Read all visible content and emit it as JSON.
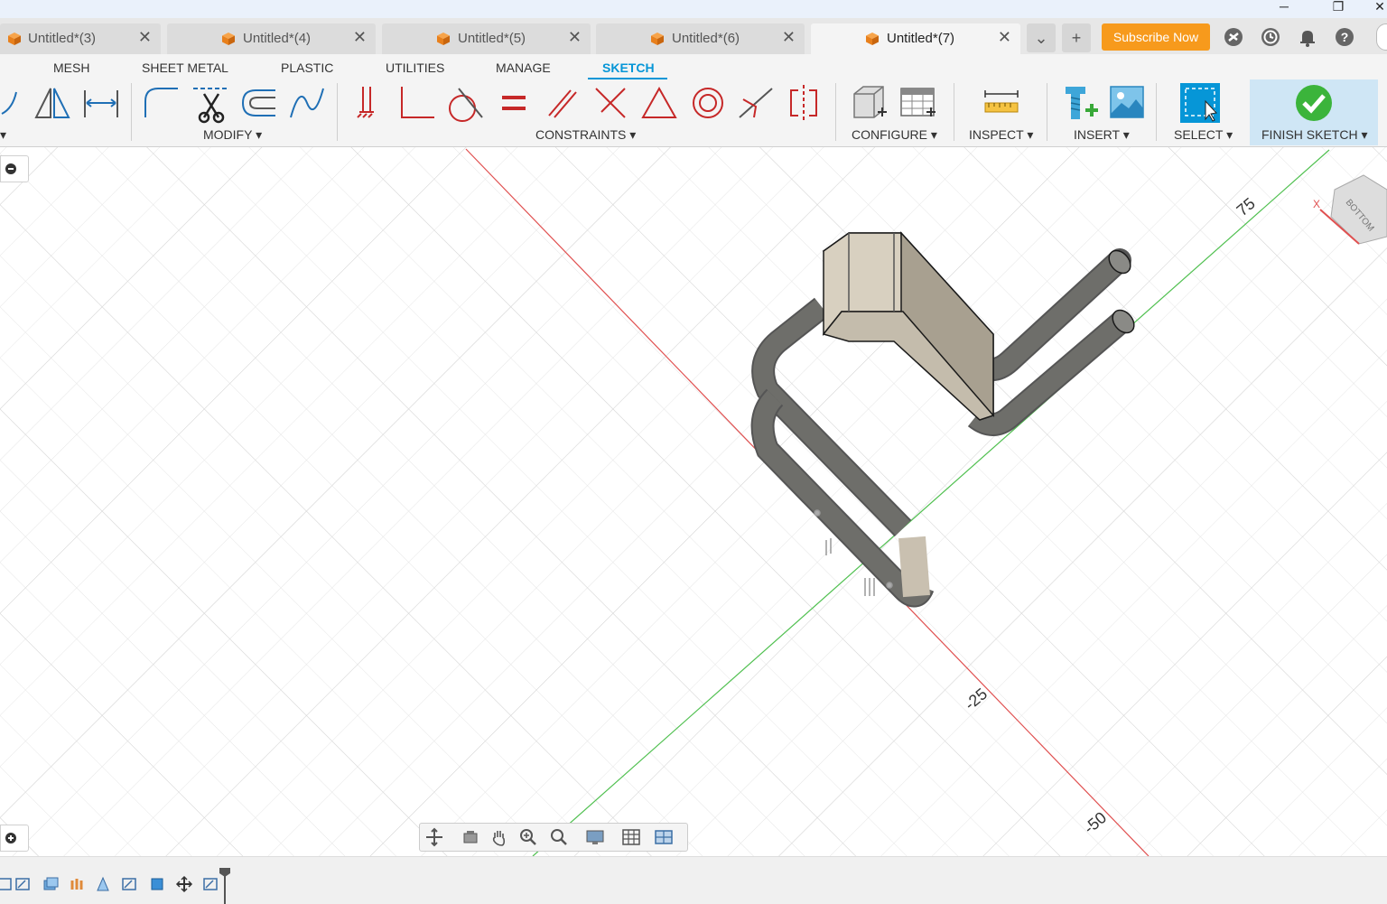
{
  "window": {
    "minimize_glyph": "─",
    "restore_glyph": "❐",
    "close_glyph": "✕"
  },
  "tabs": [
    {
      "label": "Untitled*(3)",
      "active": false
    },
    {
      "label": "Untitled*(4)",
      "active": false
    },
    {
      "label": "Untitled*(5)",
      "active": false
    },
    {
      "label": "Untitled*(6)",
      "active": false
    },
    {
      "label": "Untitled*(7)",
      "active": true
    }
  ],
  "tab_close_glyph": "✕",
  "tab_overflow_glyph": "⌄",
  "new_tab_glyph": "+",
  "subscribe_label": "Subscribe Now",
  "header_icons": [
    "extensions-icon",
    "job-status-icon",
    "notifications-icon",
    "help-icon"
  ],
  "ribbon_tabs": [
    {
      "label": "MESH",
      "active": false
    },
    {
      "label": "SHEET METAL",
      "active": false
    },
    {
      "label": "PLASTIC",
      "active": false
    },
    {
      "label": "UTILITIES",
      "active": false
    },
    {
      "label": "MANAGE",
      "active": false
    },
    {
      "label": "SKETCH",
      "active": true
    }
  ],
  "groups": {
    "create": "▾",
    "modify": "MODIFY ▾",
    "constraints": "CONSTRAINTS ▾",
    "configure": "CONFIGURE ▾",
    "inspect": "INSPECT ▾",
    "insert": "INSERT ▾",
    "select": "SELECT ▾",
    "finish": "FINISH SKETCH ▾"
  },
  "viewport": {
    "axis_labels": [
      "75",
      "-25",
      "-50"
    ],
    "viewcube_face": "BOTTOM",
    "viewcube_axis": "X",
    "x_axis_color": "#e05050",
    "y_axis_color": "#50c050"
  },
  "side_buttons": {
    "collapse": "−",
    "expand": "+"
  },
  "accent_color": "#0696d7",
  "subscribe_color": "#f79a1c"
}
